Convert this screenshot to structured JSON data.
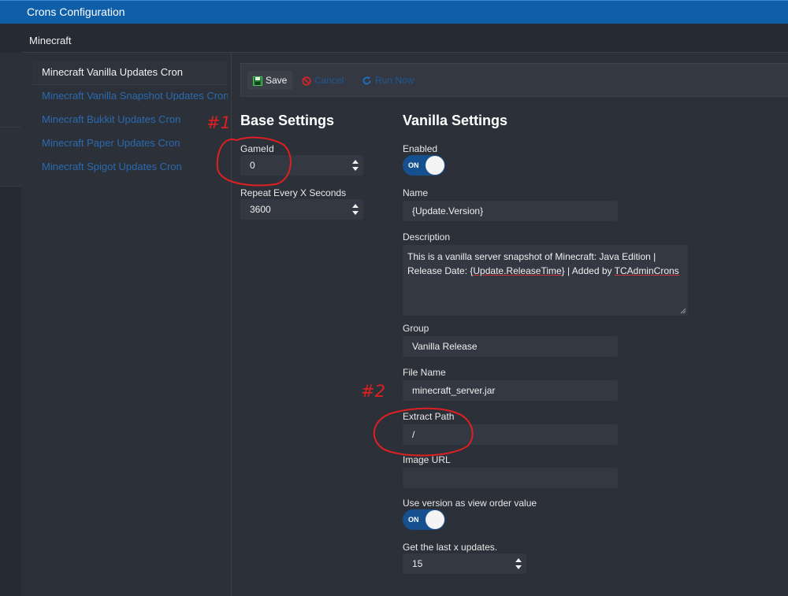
{
  "window": {
    "title": "Crons Configuration"
  },
  "section": {
    "tab": "Minecraft"
  },
  "crons": [
    {
      "label": "Minecraft Vanilla Updates Cron",
      "active": true
    },
    {
      "label": "Minecraft Vanilla Snapshot Updates Cron",
      "active": false
    },
    {
      "label": "Minecraft Bukkit Updates Cron",
      "active": false
    },
    {
      "label": "Minecraft Paper Updates Cron",
      "active": false
    },
    {
      "label": "Minecraft Spigot Updates Cron",
      "active": false
    }
  ],
  "toolbar": {
    "save": "Save",
    "cancel": "Cancel",
    "run": "Run Now"
  },
  "base": {
    "title": "Base Settings",
    "gameid_label": "GameId",
    "gameid_value": "0",
    "repeat_label": "Repeat Every X Seconds",
    "repeat_value": "3600"
  },
  "vanilla": {
    "title": "Vanilla Settings",
    "enabled_label": "Enabled",
    "enabled_state": "ON",
    "name_label": "Name",
    "name_value": "{Update.Version}",
    "desc_label": "Description",
    "desc_p1": "This is a vanilla server snapshot of Minecraft: Java Edition | Release Date: {",
    "desc_p2": "Update.ReleaseTime",
    "desc_p3": "} | Added by ",
    "desc_p4": "TCAdminCrons",
    "group_label": "Group",
    "group_value": "Vanilla Release",
    "filename_label": "File Name",
    "filename_value": "minecraft_server.jar",
    "extract_label": "Extract Path",
    "extract_value": "/",
    "image_label": "Image URL",
    "image_value": "",
    "vieworder_label": "Use version as view order value",
    "vieworder_state": "ON",
    "lastx_label": "Get the last x updates.",
    "lastx_value": "15"
  },
  "annotations": {
    "mark1": "#1",
    "mark2": "#2"
  },
  "colors": {
    "titlebar": "#0f5fa8",
    "link": "#2a6bb0",
    "toggle_on": "#17508e",
    "annotation": "#e02020"
  }
}
